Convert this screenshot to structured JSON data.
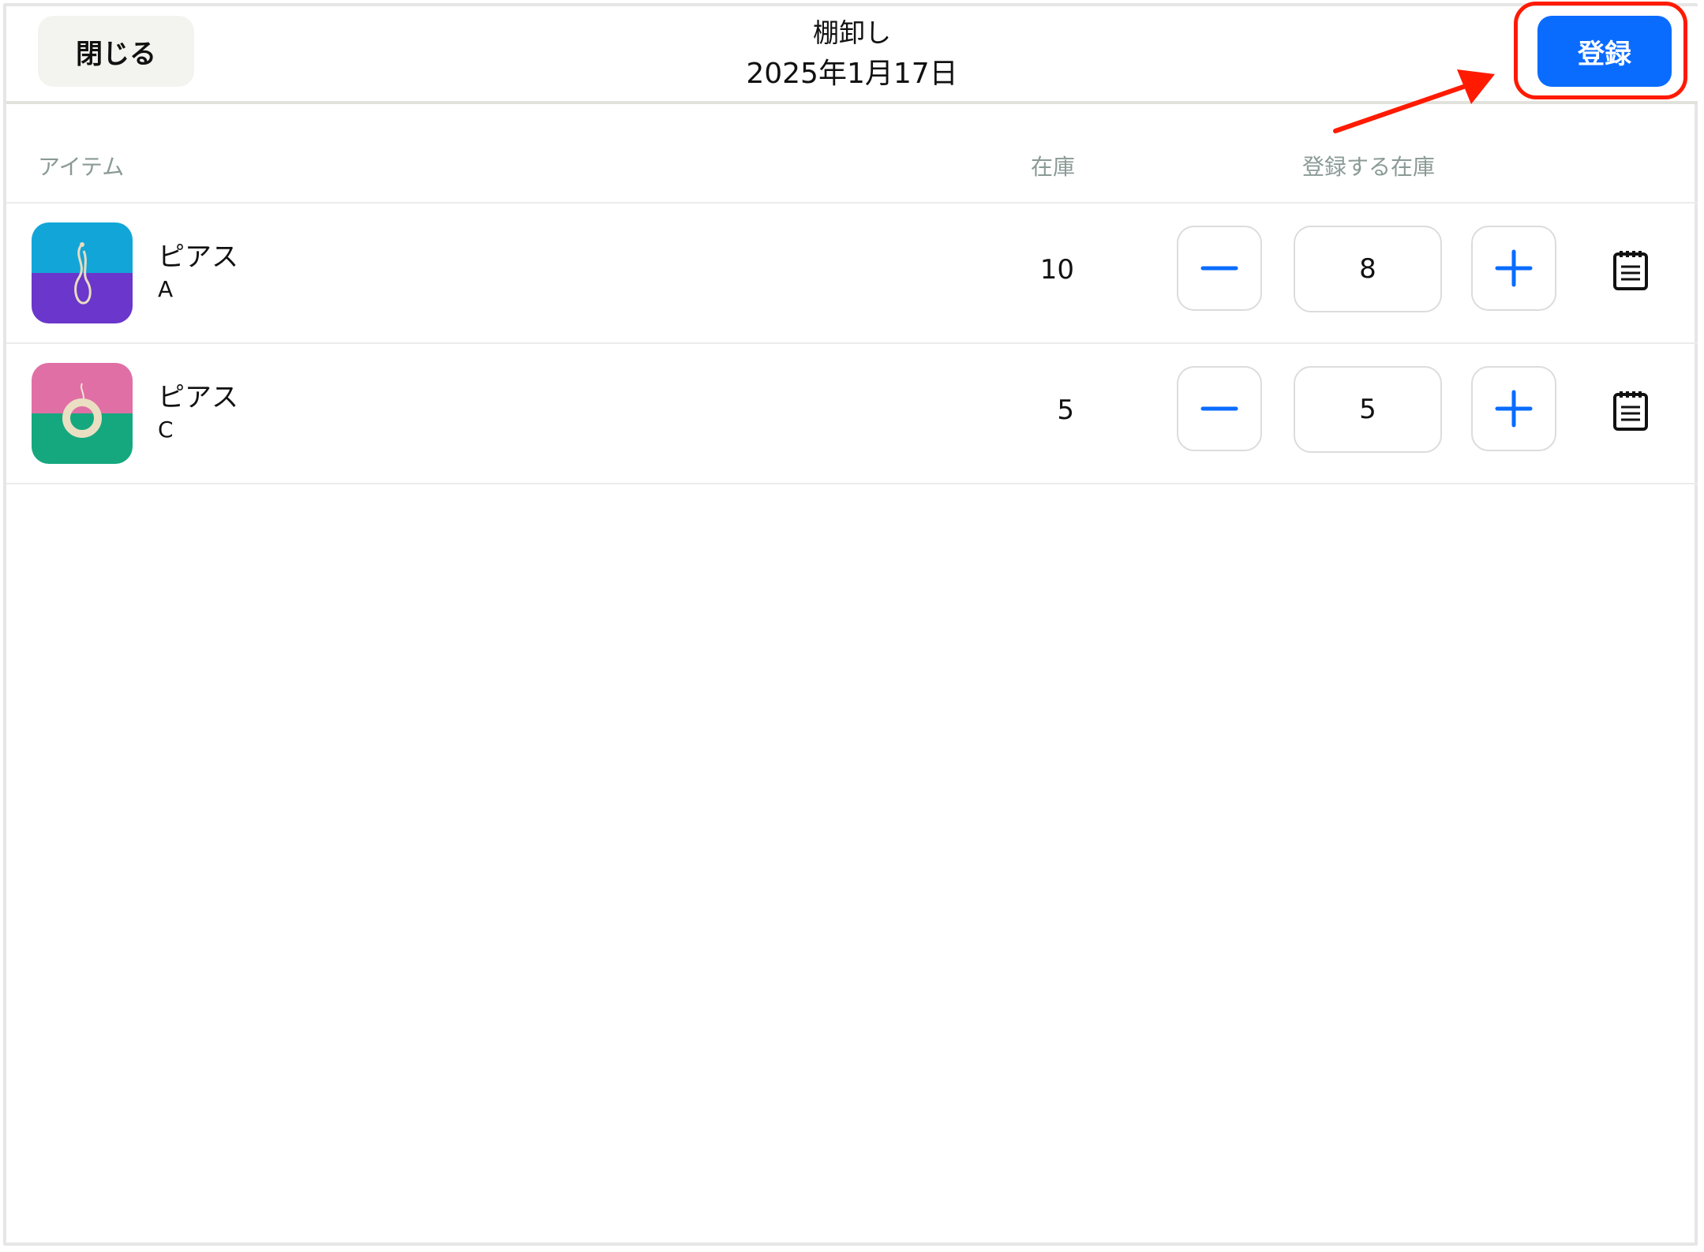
{
  "header": {
    "close_label": "閉じる",
    "title": "棚卸し",
    "date": "2025年1月17日",
    "register_label": "登録"
  },
  "columns": {
    "item": "アイテム",
    "stock": "在庫",
    "register_stock": "登録する在庫"
  },
  "items": [
    {
      "name": "ピアス",
      "variant": "A",
      "stock": "10",
      "register_qty": "8",
      "thumb_top": "#12a6d8",
      "thumb_bottom": "#6a36cc",
      "icon": "earring-thumbnail-icon"
    },
    {
      "name": "ピアス",
      "variant": "C",
      "stock": "5",
      "register_qty": "5",
      "thumb_top": "#e06fa6",
      "thumb_bottom": "#15a87f",
      "icon": "earring-thumbnail-icon"
    }
  ],
  "colors": {
    "accent": "#0a6cff",
    "annotation": "#ff1a00"
  }
}
